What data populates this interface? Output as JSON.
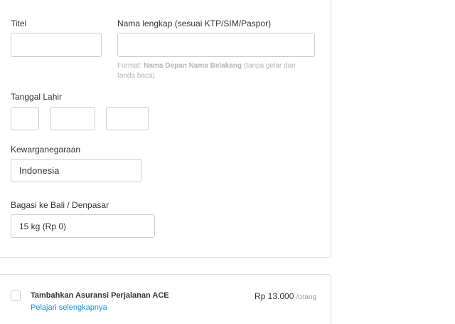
{
  "form": {
    "title_label": "Titel",
    "title_value": "",
    "fullname_label": "Nama lengkap (sesuai KTP/SIM/Paspor)",
    "fullname_value": "",
    "fullname_hint_prefix": "Format: ",
    "fullname_hint_bold": "Nama Depan Nama Belakang",
    "fullname_hint_suffix": " (tanpa gelar dan tanda baca)",
    "dob_label": "Tanggal Lahir",
    "dob_day": "",
    "dob_month": "",
    "dob_year": "",
    "nationality_label": "Kewarganegaraan",
    "nationality_value": "Indonesia",
    "baggage_label": "Bagasi ke Bali / Denpasar",
    "baggage_value": "15 kg (Rp 0)"
  },
  "insurance": {
    "title": "Tambahkan Asuransi Perjalanan ACE",
    "link": "Pelajari selengkapnya",
    "price": "Rp 13.000",
    "per": "/orang"
  }
}
